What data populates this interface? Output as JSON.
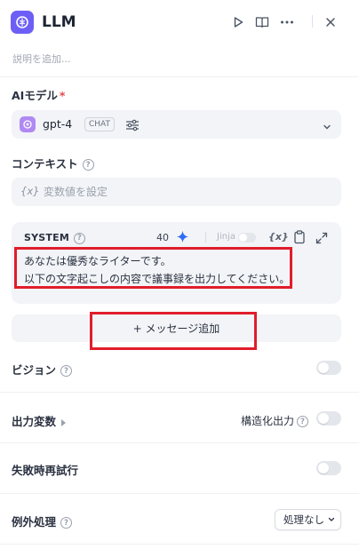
{
  "header": {
    "title": "LLM",
    "description_placeholder": "説明を追加...",
    "icon": "brain-icon",
    "actions": [
      "play-icon",
      "book-icon",
      "more-icon",
      "close-icon"
    ]
  },
  "model": {
    "label": "AIモデル",
    "required_mark": "*",
    "name": "gpt-4",
    "badge": "CHAT"
  },
  "context": {
    "label": "コンテキスト",
    "var_symbol": "{x}",
    "placeholder": "変数値を設定"
  },
  "system_prompt": {
    "role": "SYSTEM",
    "char_count": "40",
    "jinja_label": "Jinja",
    "var_symbol": "{x}",
    "text": "あなたは優秀なライターです。\n以下の文字起こしの内容で議事録を出力してください。"
  },
  "add_message": {
    "label": "+ メッセージ追加"
  },
  "vision": {
    "label": "ビジョン",
    "enabled": false
  },
  "output": {
    "label": "出力変数",
    "structured_label": "構造化出力",
    "structured_enabled": false
  },
  "retry": {
    "label": "失敗時再試行",
    "enabled": false
  },
  "error_handling": {
    "label": "例外処理",
    "selected": "処理なし"
  },
  "colors": {
    "accent": "#6d5ff5",
    "model_logo": "#b089f3",
    "highlight_border": "#e11d2b",
    "spark": "#2f6cf6"
  }
}
